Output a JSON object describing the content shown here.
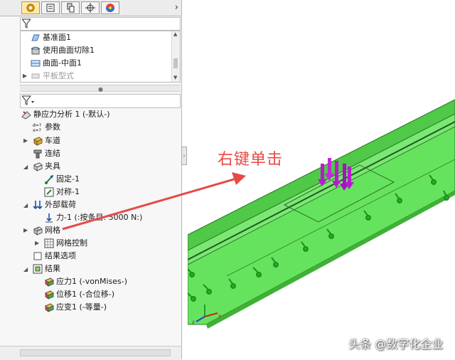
{
  "tabs": [
    "feature-manager",
    "property-manager",
    "configuration-manager",
    "dimxpert-manager",
    "display-manager"
  ],
  "top_tree": [
    {
      "label": "基准面1",
      "icon": "plane-icon",
      "muted": false
    },
    {
      "label": "使用曲面切除1",
      "icon": "surface-cut-icon",
      "muted": false
    },
    {
      "label": "曲面-中面1",
      "icon": "midsurface-icon",
      "muted": false
    },
    {
      "label": "平板型式",
      "icon": "flat-pattern-icon",
      "muted": true
    }
  ],
  "study": {
    "title": "静应力分析 1 (-默认-)",
    "items": [
      {
        "label": "参数",
        "icon": "parameters-icon",
        "level": 1
      },
      {
        "label": "车道",
        "icon": "part-icon",
        "level": 1,
        "caret": true
      },
      {
        "label": "连结",
        "icon": "connection-icon",
        "level": 1
      },
      {
        "label": "夹具",
        "icon": "fixture-icon",
        "level": 1,
        "caret": true
      },
      {
        "label": "固定-1",
        "icon": "fixed-icon",
        "level": 2
      },
      {
        "label": "对称-1",
        "icon": "symmetry-icon",
        "level": 2
      },
      {
        "label": "外部载荷",
        "icon": "external-load-icon",
        "level": 1,
        "caret": true
      },
      {
        "label": "力-1 (:按条目: 5000 N:)",
        "icon": "force-icon",
        "level": 2
      },
      {
        "label": "网格",
        "icon": "mesh-icon",
        "level": 1,
        "caret": true
      },
      {
        "label": "网格控制",
        "icon": "mesh-control-icon",
        "level": 2,
        "caret": true
      },
      {
        "label": "结果选项",
        "icon": "result-options-icon",
        "level": 1
      },
      {
        "label": "结果",
        "icon": "results-folder-icon",
        "level": 1,
        "caret": true
      },
      {
        "label": "应力1 (-vonMises-)",
        "icon": "stress-plot-icon",
        "level": 2
      },
      {
        "label": "位移1 (-合位移-)",
        "icon": "displacement-plot-icon",
        "level": 2
      },
      {
        "label": "应变1 (-等量-)",
        "icon": "strain-plot-icon",
        "level": 2
      }
    ]
  },
  "annotation": "右键单击",
  "watermark": "头条 @数字化企业",
  "colors": {
    "model_green": "#63e35d",
    "annotation_red": "#e74a45",
    "fixture_green": "#1ea61e",
    "load_magenta": "#b81ad0"
  }
}
